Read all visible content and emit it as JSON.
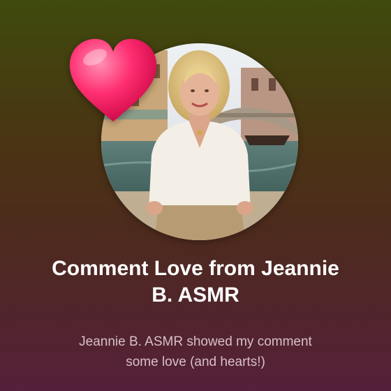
{
  "notification": {
    "title_lines": [
      "Comment Love from Jeannie",
      "B. ASMR"
    ],
    "message_lines": [
      "Jeannie B. ASMR showed my comment",
      "some love (and hearts!)"
    ]
  },
  "icons": {
    "heart": "heart-icon",
    "avatar": "avatar-photo"
  },
  "colors": {
    "heart": "#ff2f72",
    "title": "#ffffff",
    "message": "#d8c0c6",
    "background_top": "#3f4a0d",
    "background_bottom": "#55203a"
  }
}
